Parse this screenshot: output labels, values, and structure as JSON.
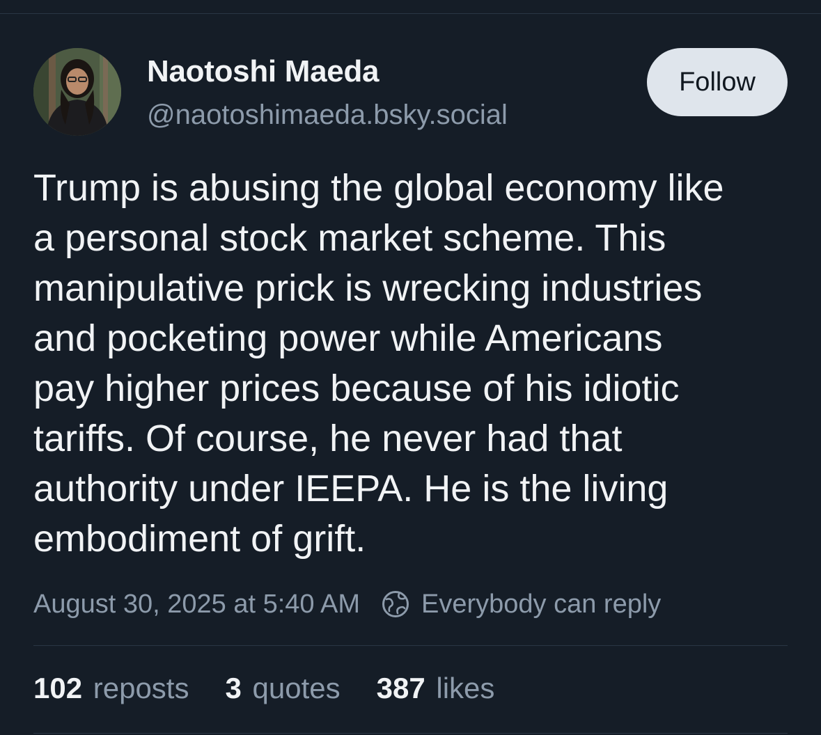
{
  "author": {
    "display_name": "Naotoshi Maeda",
    "handle": "@naotoshimaeda.bsky.social",
    "avatar_icon": "user-photo"
  },
  "follow_label": "Follow",
  "post": {
    "lines": [
      "Trump is abusing the global economy like",
      "a personal stock market scheme. This",
      "manipulative prick is wrecking industries",
      "and pocketing power while Americans",
      "pay higher prices because of his idiotic",
      "tariffs. Of course, he never had that",
      "authority under IEEPA. He is the living",
      "embodiment of grift."
    ],
    "timestamp": "August 30, 2025 at 5:40 AM",
    "reply_setting": "Everybody can reply",
    "reply_icon": "globe-icon"
  },
  "stats": {
    "reposts_count": "102",
    "reposts_label": "reposts",
    "quotes_count": "3",
    "quotes_label": "quotes",
    "likes_count": "387",
    "likes_label": "likes"
  },
  "colors": {
    "background": "#151d27",
    "primary_text": "#f1f3f5",
    "secondary_text": "#8d9bab",
    "follow_button_bg": "#dfe5ec",
    "divider": "#2a3644"
  }
}
